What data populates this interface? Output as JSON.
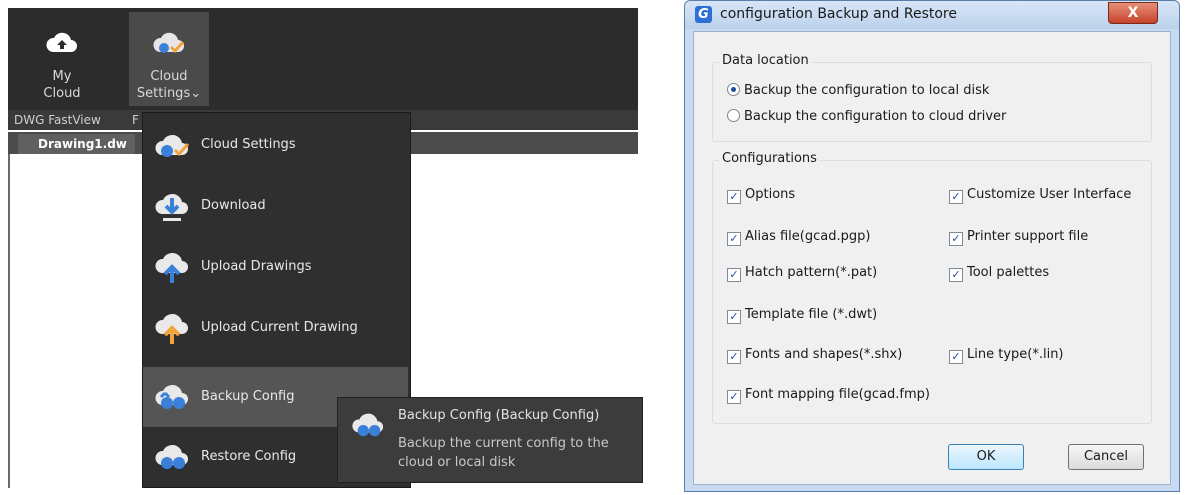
{
  "ribbon": {
    "my_cloud_label": "My\nCloud",
    "cloud_settings_label": "Cloud\nSettings⌄",
    "panel_label_1": "DWG FastView",
    "panel_label_2": "F"
  },
  "tab": {
    "label": "Drawing1.dw"
  },
  "menu": {
    "items": [
      {
        "label": "Cloud Settings",
        "icon": "cloud-settings-icon"
      },
      {
        "label": "Download",
        "icon": "cloud-download-icon"
      },
      {
        "label": "Upload Drawings",
        "icon": "cloud-upload-icon"
      },
      {
        "label": "Upload Current Drawing",
        "icon": "cloud-upload-current-icon"
      },
      {
        "label": "Backup Config",
        "icon": "cloud-backup-icon"
      },
      {
        "label": "Restore Config",
        "icon": "cloud-restore-icon"
      }
    ]
  },
  "tooltip": {
    "title": "Backup Config (Backup Config)",
    "description": "Backup the current config to the cloud or local disk"
  },
  "dialog": {
    "app_icon_letter": "G",
    "title": "configuration Backup and Restore",
    "data_location": {
      "title": "Data location",
      "options": [
        {
          "label": "Backup the configuration to local disk",
          "selected": true
        },
        {
          "label": "Backup the configuration to cloud driver",
          "selected": false
        }
      ]
    },
    "configurations": {
      "title": "Configurations",
      "items": [
        {
          "label": "Options",
          "checked": true
        },
        {
          "label": "Customize User Interface",
          "checked": true
        },
        {
          "label": "Alias file(gcad.pgp)",
          "checked": true
        },
        {
          "label": "Printer support file",
          "checked": true
        },
        {
          "label": "Hatch pattern(*.pat)",
          "checked": true
        },
        {
          "label": "Tool palettes",
          "checked": true
        },
        {
          "label": "Template file (*.dwt)",
          "checked": true
        },
        {
          "label": "Fonts and shapes(*.shx)",
          "checked": true
        },
        {
          "label": "Line type(*.lin)",
          "checked": true
        },
        {
          "label": "Font mapping file(gcad.fmp)",
          "checked": true
        }
      ]
    },
    "ok_label": "OK",
    "cancel_label": "Cancel",
    "close_glyph": "X"
  },
  "colors": {
    "accent": "#2d6fd6",
    "dark_ui": "#2c2c2c",
    "menu_highlight": "#555555"
  }
}
